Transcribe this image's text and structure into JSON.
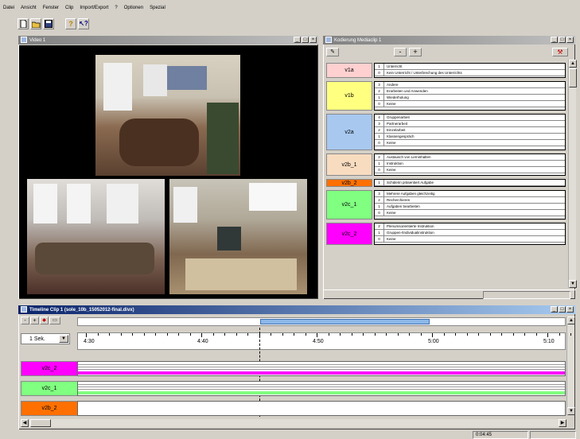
{
  "menu": [
    "Datei",
    "Ansicht",
    "Fenster",
    "Clip",
    "Import/Export",
    "?",
    "Optionen",
    "Spezial"
  ],
  "toolbar": {
    "icons": [
      "new-file-icon",
      "open-folder-icon",
      "save-icon",
      "help-icon",
      "context-help-icon"
    ]
  },
  "video_window": {
    "title": "Video 1"
  },
  "coding_window": {
    "title": "Kodierung Mediaclip 1",
    "minus": "-",
    "plus": "+",
    "categories": [
      {
        "label": "v1a",
        "color": "#ffd0d0",
        "rows": [
          [
            "1",
            "Unterricht"
          ],
          [
            "0",
            "Kein Unterricht / Unterbrechung des Unterrichts"
          ]
        ]
      },
      {
        "label": "v1b",
        "color": "#ffff80",
        "rows": [
          [
            "3",
            "Andere"
          ],
          [
            "2",
            "Erarbeiten und Anwenden"
          ],
          [
            "1",
            "Wiederholung"
          ],
          [
            "0",
            "Keine"
          ]
        ]
      },
      {
        "label": "v2a",
        "color": "#a8c8f0",
        "rows": [
          [
            "4",
            "Gruppenarbeit"
          ],
          [
            "3",
            "Partnerarbeit"
          ],
          [
            "2",
            "Einzelarbeit"
          ],
          [
            "1",
            "Klassengespräch"
          ],
          [
            "0",
            "Keine"
          ]
        ]
      },
      {
        "label": "v2b_1",
        "color": "#f8dcc0",
        "rows": [
          [
            "2",
            "Austausch von Lerninhalten"
          ],
          [
            "1",
            "Instruktion"
          ],
          [
            "0",
            "Keine"
          ]
        ]
      },
      {
        "label": "v2b_2",
        "color": "#ff7000",
        "rows": [
          [
            "1",
            "Schülerin präsentiert Aufgabe"
          ]
        ]
      },
      {
        "label": "v2c_1",
        "color": "#80ff80",
        "rows": [
          [
            "3",
            "Mehrere Aufgaben gleichzeitig"
          ],
          [
            "2",
            "Recherchieren"
          ],
          [
            "1",
            "Aufgaben bearbeiten"
          ],
          [
            "0",
            "Keine"
          ]
        ]
      },
      {
        "label": "v2c_2",
        "color": "#ff00ff",
        "rows": [
          [
            "2",
            "Plenumsorientierte Instruktion"
          ],
          [
            "1",
            "Gruppen-/Individualinstruktion"
          ],
          [
            "0",
            "Keine"
          ]
        ]
      }
    ]
  },
  "timeline": {
    "title": "Timeline Clip 1 (sole_10b_15052012-final.divx)",
    "scale": "1 Sek.",
    "ticks": [
      "4:30",
      "4:40",
      "4:50",
      "5:00",
      "5:10"
    ],
    "tracks": [
      {
        "label": "v2c_2",
        "color": "#ff00ff"
      },
      {
        "label": "v2c_1",
        "color": "#80ff80"
      },
      {
        "label": "v2b_2",
        "color": "#ff7000"
      }
    ],
    "time": "0:04:45"
  }
}
